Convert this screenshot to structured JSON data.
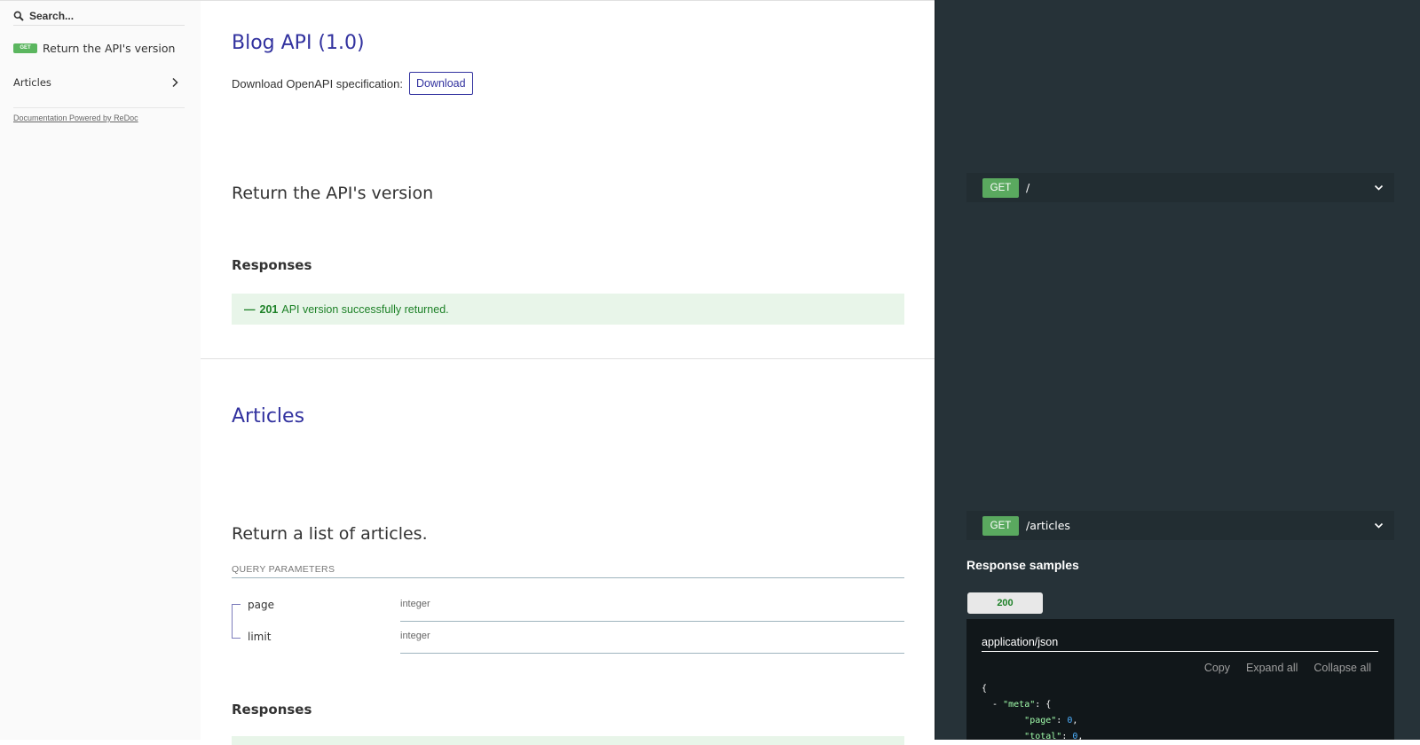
{
  "sidebar": {
    "search_placeholder": "Search...",
    "items": [
      {
        "badge": "GET",
        "label": "Return the API's version"
      },
      {
        "label": "Articles"
      }
    ],
    "powered_by": "Documentation Powered by ReDoc"
  },
  "main": {
    "title": "Blog API (1.0)",
    "download_text": "Download OpenAPI specification:",
    "download_label": "Download",
    "op1": {
      "title": "Return the API's version",
      "responses_title": "Responses",
      "response": {
        "dash": "—",
        "code": "201",
        "description": "API version successfully returned."
      }
    },
    "section_title": "Articles",
    "op2": {
      "title": "Return a list of articles.",
      "query_params_title": "QUERY PARAMETERS",
      "params": [
        {
          "name": "page",
          "type": "integer"
        },
        {
          "name": "limit",
          "type": "integer"
        }
      ],
      "responses_title": "Responses"
    }
  },
  "right": {
    "endpoints": [
      {
        "verb": "GET",
        "path": "/"
      },
      {
        "verb": "GET",
        "path": "/articles"
      }
    ],
    "response_samples_title": "Response samples",
    "status_tab": "200",
    "content_type": "application/json",
    "actions": {
      "copy": "Copy",
      "expand": "Expand all",
      "collapse": "Collapse all"
    },
    "json": {
      "open_brace": "{",
      "toggle": "-",
      "meta_key": "\"meta\"",
      "meta_open": ": {",
      "page_key": "\"page\"",
      "page_value": "0",
      "total_key": "\"total\"",
      "total_value": "0"
    }
  },
  "colors": {
    "accent": "#32329f",
    "get_badge": "#5bb65f",
    "success_text": "#1d8127",
    "success_bg": "#e8f5e9",
    "right_panel": "#263238",
    "code_bg": "#11171a"
  }
}
